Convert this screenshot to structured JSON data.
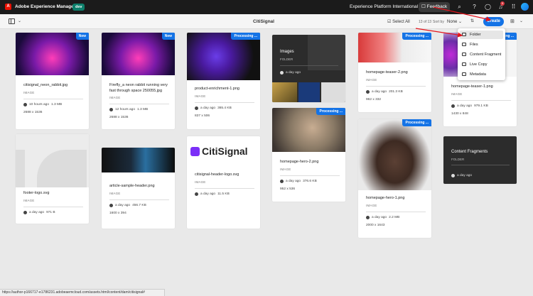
{
  "shell": {
    "app_name": "Adobe Experience Manager",
    "env_badge": "dev",
    "org_name": "Experience Platform International",
    "feedback_label": "Feedback",
    "notification_count": "9"
  },
  "actionbar": {
    "title": "CitiSignal",
    "select_all_label": "Select All",
    "count": "13 of 13",
    "sort_by_label": "Sort by",
    "sort_value": "None",
    "create_label": "Create"
  },
  "create_menu": {
    "items": [
      "Folder",
      "Files",
      "Content Fragment",
      "Live Copy",
      "Metadata"
    ]
  },
  "assets": [
    {
      "name": "citisignal_neon_rabbit.jpg",
      "type": "IMAGE",
      "time": "10 hours ago",
      "size": "1.3 MB",
      "dims": "2688 x 1536",
      "badge": "New"
    },
    {
      "name": "Firefly_a neon rabbit running very fast through space 250055.jpg",
      "type": "IMAGE",
      "time": "12 hours ago",
      "size": "1.3 MB",
      "dims": "2688 x 1536",
      "badge": "New"
    },
    {
      "name": "product-enrichment-1.png",
      "type": "IMAGE",
      "time": "a day ago",
      "size": "365.4 KB",
      "dims": "837 x 506",
      "badge": "Processing ..."
    },
    {
      "name": "Images",
      "type": "FOLDER",
      "time": "a day ago"
    },
    {
      "name": "homepage-teaser-2.png",
      "type": "IMAGE",
      "time": "a day ago",
      "size": "201.3 KB",
      "dims": "962 x 332",
      "badge": "Processing ..."
    },
    {
      "name": "homepage-teaser-1.png",
      "type": "IMAGE",
      "time": "a day ago",
      "size": "979.1 KB",
      "dims": "1430 x 848",
      "badge": "Processing ..."
    },
    {
      "name": "footer-logo.svg",
      "type": "IMAGE",
      "time": "a day ago",
      "size": "971 B"
    },
    {
      "name": "article-sample-header.png",
      "type": "IMAGE",
      "time": "a day ago",
      "size": "456.7 KB",
      "dims": "1600 x 394"
    },
    {
      "name": "citisignal-header-logo.svg",
      "type": "IMAGE",
      "time": "a day ago",
      "size": "11.5 KB",
      "logo_text": "CitiSignal"
    },
    {
      "name": "homepage-hero-2.png",
      "type": "IMAGE",
      "time": "a day ago",
      "size": "376.6 KB",
      "dims": "952 x 536",
      "badge": "Processing ..."
    },
    {
      "name": "homepage-hero-1.png",
      "type": "IMAGE",
      "time": "a day ago",
      "size": "2.2 MB",
      "dims": "2000 x 1643",
      "badge": "Processing ..."
    },
    {
      "name": "Content Fragments",
      "type": "FOLDER",
      "time": "a day ago"
    }
  ],
  "status_url": "https://author-p166717-e1786231.adobeaemcloud.com/assets.html/content/dam/citisignal#",
  "colors": {
    "accent": "#1473e6",
    "shell": "#1b1b1b",
    "annotation": "#e3131b"
  }
}
